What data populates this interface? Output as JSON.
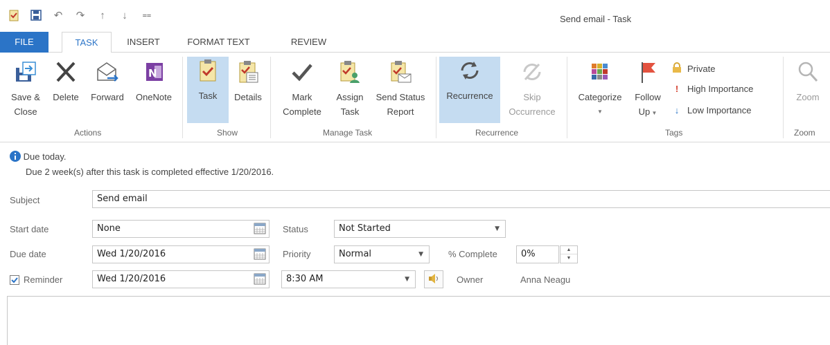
{
  "window": {
    "title": "Send email - Task"
  },
  "qat": {
    "icons": [
      "task-icon",
      "save-icon",
      "undo-icon",
      "redo-icon",
      "up-icon",
      "down-icon",
      "customize-icon"
    ]
  },
  "tabs": [
    "FILE",
    "TASK",
    "INSERT",
    "FORMAT TEXT",
    "REVIEW"
  ],
  "active_tab": "TASK",
  "ribbon": {
    "actions": {
      "group": "Actions",
      "save_close_1": "Save &",
      "save_close_2": "Close",
      "delete": "Delete",
      "forward": "Forward",
      "onenote": "OneNote"
    },
    "show": {
      "group": "Show",
      "task": "Task",
      "details": "Details"
    },
    "manage": {
      "group": "Manage Task",
      "mark_1": "Mark",
      "mark_2": "Complete",
      "assign_1": "Assign",
      "assign_2": "Task",
      "send_1": "Send Status",
      "send_2": "Report"
    },
    "recurrence": {
      "group": "Recurrence",
      "recurrence": "Recurrence",
      "skip_1": "Skip",
      "skip_2": "Occurrence"
    },
    "tags": {
      "group": "Tags",
      "categorize": "Categorize",
      "follow_1": "Follow",
      "follow_2": "Up",
      "private": "Private",
      "high": "High Importance",
      "low": "Low Importance"
    },
    "zoom": {
      "group": "Zoom",
      "zoom": "Zoom"
    }
  },
  "info": {
    "line1": "Due today.",
    "line2": "Due 2 week(s) after this task is completed effective 1/20/2016."
  },
  "form": {
    "subject_label": "Subject",
    "subject_value": "Send email",
    "start_label": "Start date",
    "start_value": "None",
    "due_label": "Due date",
    "due_value": "Wed 1/20/2016",
    "reminder_label": "Reminder",
    "reminder_checked": true,
    "reminder_date": "Wed 1/20/2016",
    "reminder_time": "8:30 AM",
    "status_label": "Status",
    "status_value": "Not Started",
    "priority_label": "Priority",
    "priority_value": "Normal",
    "complete_label": "% Complete",
    "complete_value": "0%",
    "owner_label": "Owner",
    "owner_value": "Anna Neagu"
  },
  "colors": {
    "accent": "#2b74c7",
    "selected": "#c5dcf1",
    "onenote": "#7b3fa3",
    "flag": "#e3523f"
  }
}
